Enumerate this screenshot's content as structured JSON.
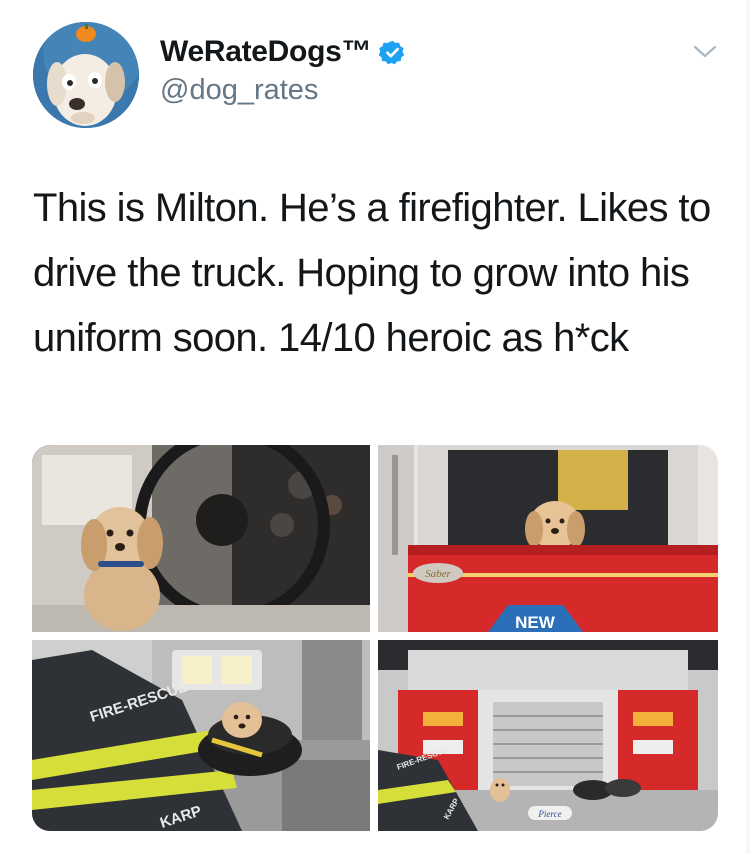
{
  "author": {
    "display_name": "WeRateDogs™",
    "handle": "@dog_rates",
    "verified": true,
    "avatar_icon": "dog-avatar"
  },
  "tweet": {
    "text": "This is Milton. He’s a firefighter. Likes to drive the truck. Hoping to grow into his uniform soon. 14/10 heroic as h*ck"
  },
  "media": {
    "photos": [
      {
        "label": "dog-in-driver-seat"
      },
      {
        "label": "dog-in-truck-window",
        "signs": [
          "Saber",
          "NEW"
        ]
      },
      {
        "label": "dog-in-helmet",
        "signs": [
          "FIRE-RESCUE",
          "KARP"
        ]
      },
      {
        "label": "dog-in-front-of-truck",
        "signs": [
          "Pierce",
          "FIRE-RESCUE",
          "KARP"
        ]
      }
    ]
  },
  "colors": {
    "verified_blue": "#1da1f2",
    "handle_gray": "#657786",
    "text": "#14171a",
    "truck_red": "#d62a2a"
  },
  "icons": [
    "verified-badge-icon",
    "chevron-down-icon"
  ]
}
